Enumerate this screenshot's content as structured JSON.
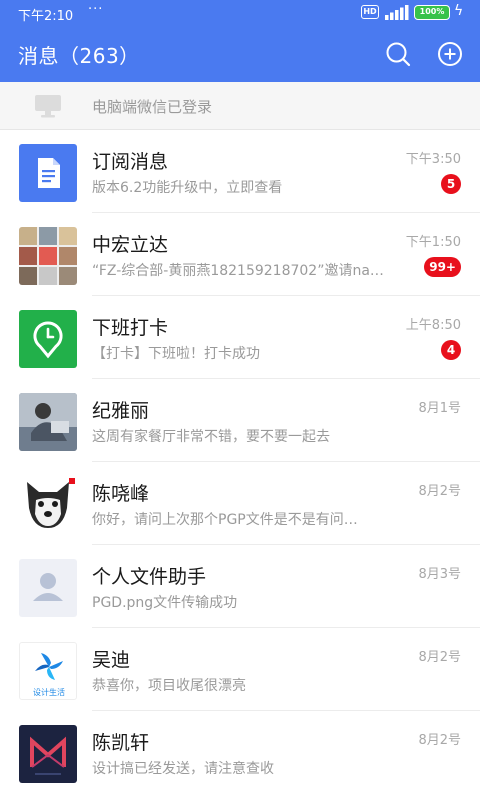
{
  "status_bar": {
    "time": "下午2:10",
    "dots": "···",
    "hd": "HD",
    "battery": "100%",
    "charge_glyph": "ϟ"
  },
  "header": {
    "title": "消息（263）",
    "search_icon": "search-icon",
    "add_icon": "plus-circle-icon",
    "accent_color": "#4a7af0"
  },
  "pc_notice": {
    "icon": "monitor-icon",
    "text": "电脑端微信已登录"
  },
  "badge_color": "#e8101c",
  "conversations": [
    {
      "name": "订阅消息",
      "preview": "版本6.2功能升级中，立即查看",
      "time": "下午3:50",
      "badge": "5",
      "avatar": "document-icon"
    },
    {
      "name": "中宏立达",
      "preview": "“FZ-综合部-黄丽燕182159218702”邀请na…",
      "time": "下午1:50",
      "badge": "99+",
      "avatar": "group-collage-avatar"
    },
    {
      "name": "下班打卡",
      "preview": "【打卡】下班啦！打卡成功",
      "time": "上午8:50",
      "badge": "4",
      "avatar": "clock-pin-icon"
    },
    {
      "name": "纪雅丽",
      "preview": "这周有家餐厅非常不错，要不要一起去",
      "time": "8月1号",
      "badge": "",
      "avatar": "photo-avatar"
    },
    {
      "name": "陈哓峰",
      "preview": "你好，请问上次那个PGP文件是不是有问…",
      "time": "8月2号",
      "badge": "",
      "avatar": "dog-avatar"
    },
    {
      "name": "个人文件助手",
      "preview": "PGD.png文件传输成功",
      "time": "8月3号",
      "badge": "",
      "avatar": "person-placeholder-icon"
    },
    {
      "name": "吴迪",
      "preview": "恭喜你，项目收尾很漂亮",
      "time": "8月2号",
      "badge": "",
      "avatar": "design-life-logo",
      "avatar_text": "设计生活"
    },
    {
      "name": "陈凯轩",
      "preview": "设计搞已经发送，请注意查收",
      "time": "8月2号",
      "badge": "",
      "avatar": "m-logo-avatar"
    }
  ]
}
